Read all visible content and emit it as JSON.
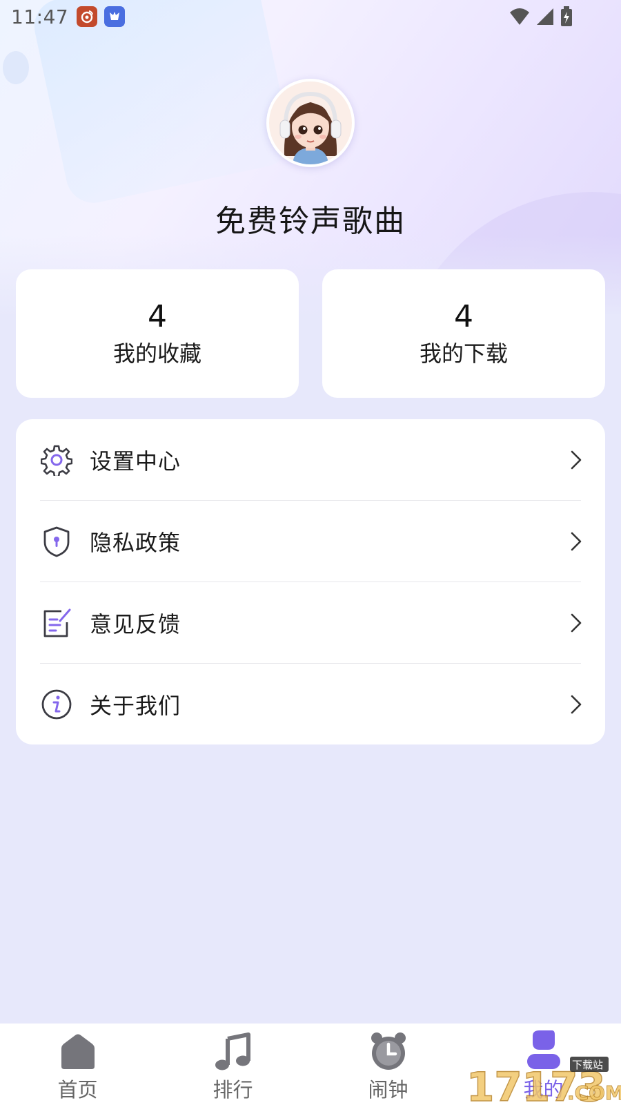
{
  "status_bar": {
    "time": "11:47"
  },
  "profile": {
    "app_name": "免费铃声歌曲"
  },
  "stats": [
    {
      "value": "4",
      "label": "我的收藏"
    },
    {
      "value": "4",
      "label": "我的下载"
    }
  ],
  "menu": [
    {
      "label": "设置中心",
      "icon": "gear-icon"
    },
    {
      "label": "隐私政策",
      "icon": "shield-icon"
    },
    {
      "label": "意见反馈",
      "icon": "feedback-icon"
    },
    {
      "label": "关于我们",
      "icon": "info-icon"
    }
  ],
  "tabs": [
    {
      "label": "首页",
      "icon": "home-icon",
      "active": false
    },
    {
      "label": "排行",
      "icon": "music-note-icon",
      "active": false
    },
    {
      "label": "闹钟",
      "icon": "alarm-clock-icon",
      "active": false
    },
    {
      "label": "我的",
      "icon": "person-icon",
      "active": true
    }
  ],
  "watermark": {
    "number": "17173",
    "badge": "下载站",
    "suffix": ".COM"
  },
  "colors": {
    "accent": "#7a62e8",
    "background": "#e7e8fb",
    "icon_gray": "#6e6e74"
  }
}
